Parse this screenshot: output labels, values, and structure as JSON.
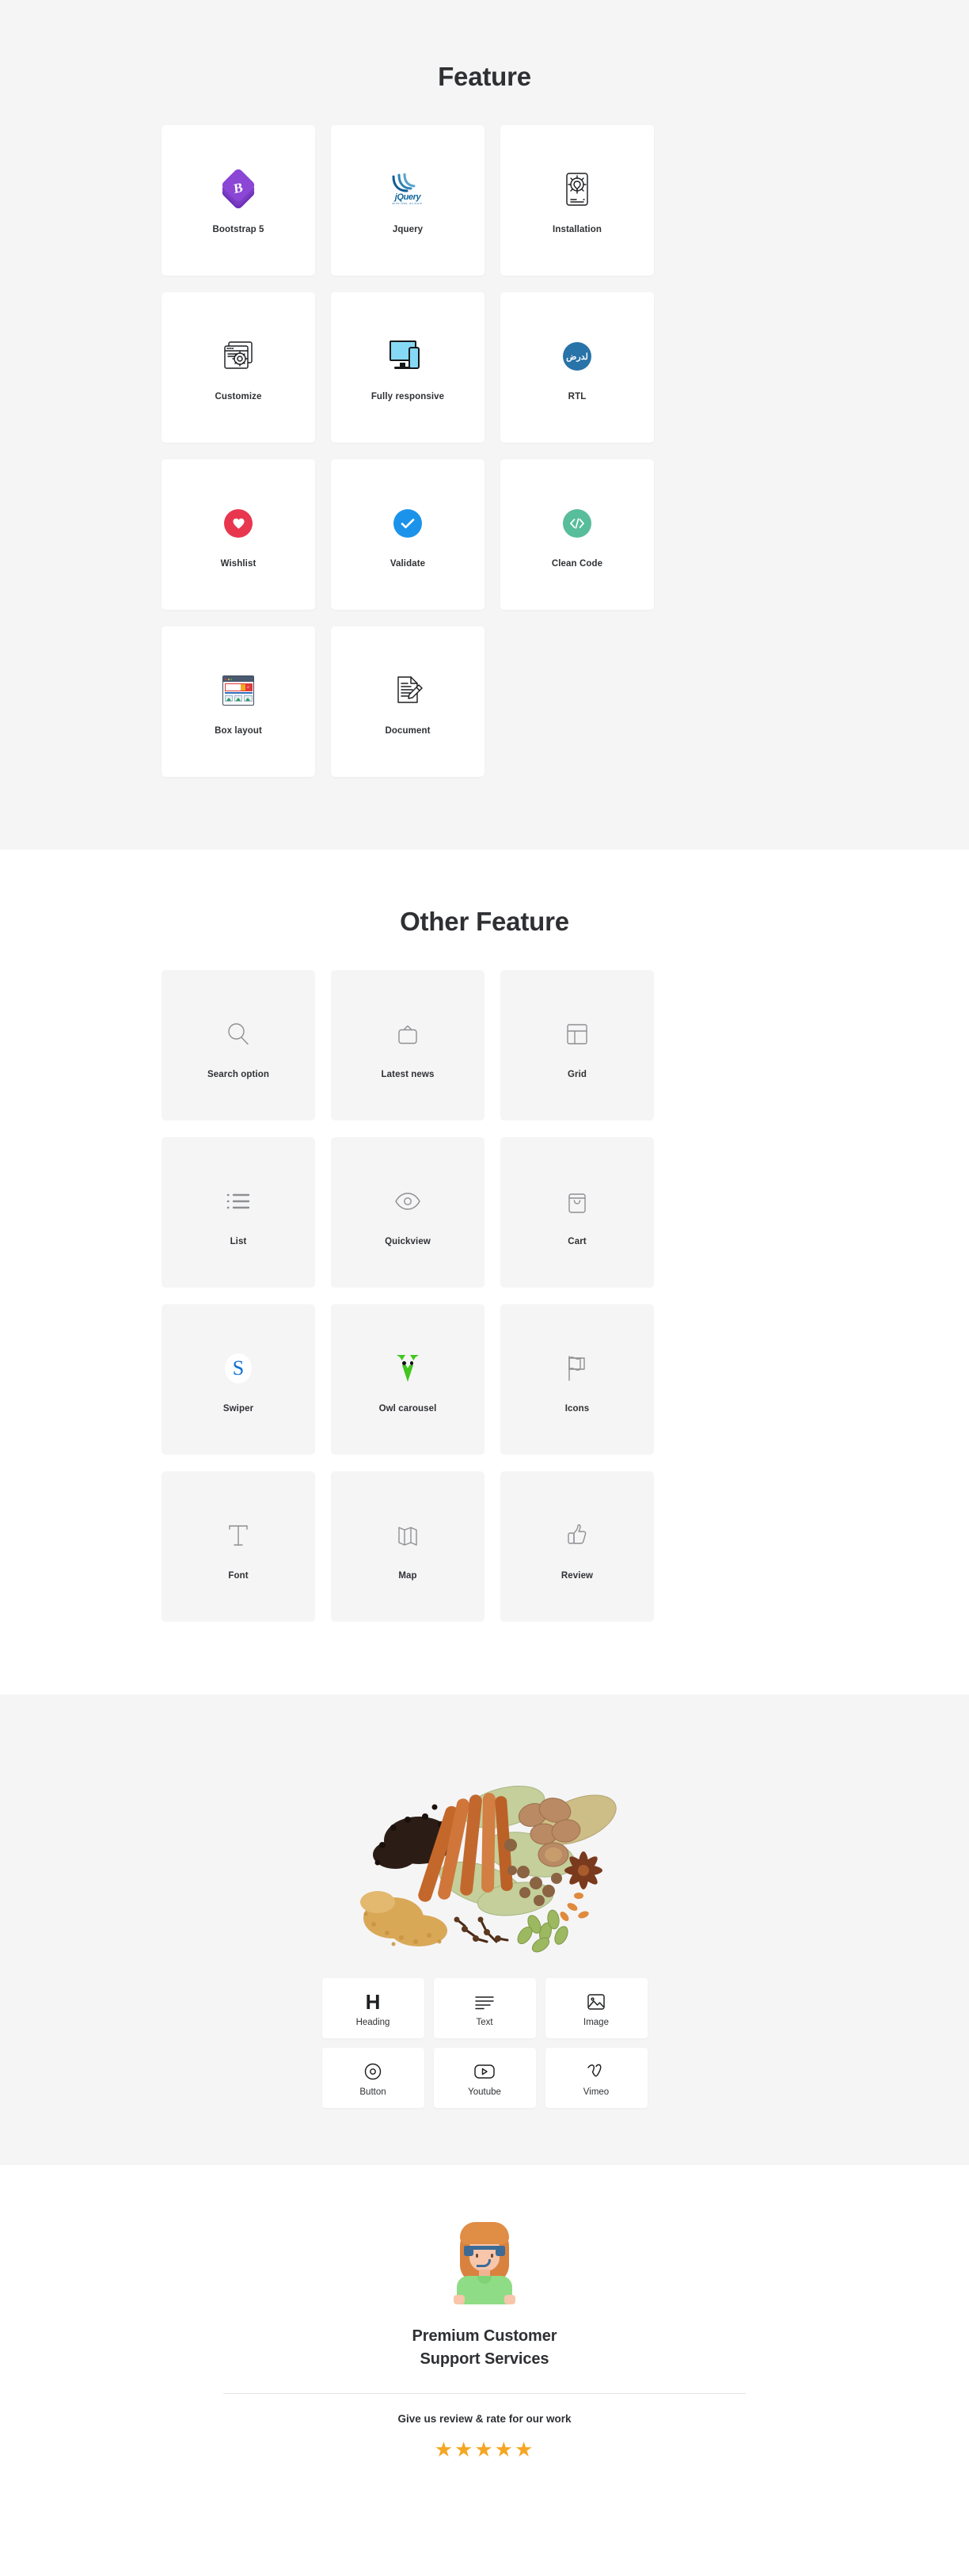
{
  "feature_section": {
    "heading": "Feature",
    "items": [
      {
        "label": "Bootstrap 5",
        "icon": "bootstrap-logo-icon"
      },
      {
        "label": "Jquery",
        "icon": "jquery-logo-icon",
        "jquery_text": "jQuery",
        "jquery_sub": "write less, do more."
      },
      {
        "label": "Installation",
        "icon": "installation-gear-mobile-icon"
      },
      {
        "label": "Customize",
        "icon": "customize-windows-gear-icon"
      },
      {
        "label": "Fully responsive",
        "icon": "monitor-phone-icon"
      },
      {
        "label": "RTL",
        "icon": "rtl-badge-icon",
        "badge_text": "لدرض"
      },
      {
        "label": "Wishlist",
        "icon": "heart-badge-icon"
      },
      {
        "label": "Validate",
        "icon": "check-badge-icon"
      },
      {
        "label": "Clean Code",
        "icon": "code-badge-icon"
      },
      {
        "label": "Box layout",
        "icon": "box-layout-browser-icon"
      },
      {
        "label": "Document",
        "icon": "document-pencil-icon"
      }
    ]
  },
  "other_feature_section": {
    "heading": "Other Feature",
    "items": [
      {
        "label": "Search option",
        "icon": "search-icon"
      },
      {
        "label": "Latest news",
        "icon": "tv-icon"
      },
      {
        "label": "Grid",
        "icon": "grid-icon"
      },
      {
        "label": "List",
        "icon": "list-icon"
      },
      {
        "label": "Quickview",
        "icon": "eye-icon"
      },
      {
        "label": "Cart",
        "icon": "shopping-bag-icon"
      },
      {
        "label": "Swiper",
        "icon": "swiper-logo-icon",
        "glyph": "S"
      },
      {
        "label": "Owl carousel",
        "icon": "owl-carousel-logo-icon"
      },
      {
        "label": "Icons",
        "icon": "flag-icon"
      },
      {
        "label": "Font",
        "icon": "text-font-icon"
      },
      {
        "label": "Map",
        "icon": "map-icon"
      },
      {
        "label": "Review",
        "icon": "thumbs-up-icon"
      }
    ]
  },
  "elements_section": {
    "hero_image_alt": "assorted-spices-photo",
    "items": [
      {
        "label": "Heading",
        "icon": "heading-h-icon",
        "glyph": "H"
      },
      {
        "label": "Text",
        "icon": "text-lines-icon"
      },
      {
        "label": "Image",
        "icon": "image-icon"
      },
      {
        "label": "Button",
        "icon": "button-circle-icon"
      },
      {
        "label": "Youtube",
        "icon": "youtube-icon"
      },
      {
        "label": "Vimeo",
        "icon": "vimeo-icon"
      }
    ]
  },
  "support_section": {
    "avatar_alt": "support-agent-avatar",
    "title_line1": "Premium Customer",
    "title_line2": "Support Services",
    "subtitle": "Give us review & rate for our work",
    "rating": 5,
    "star_glyph": "★",
    "star_color": "#f5a623"
  }
}
